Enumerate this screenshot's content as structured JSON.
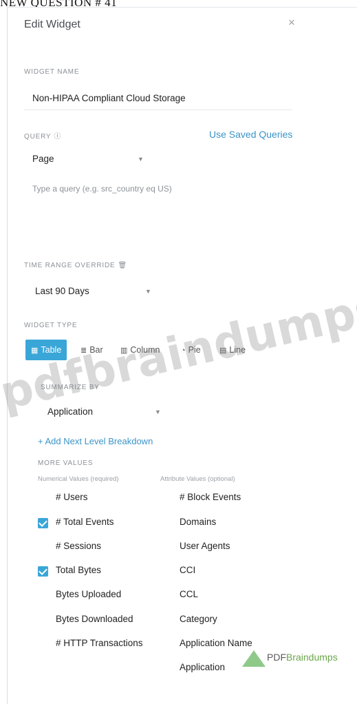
{
  "caption": "NEW QUESTION # 41",
  "dialog": {
    "title": "Edit Widget",
    "close_symbol": "×"
  },
  "widget_name": {
    "label": "WIDGET NAME",
    "value": "Non-HIPAA Compliant Cloud Storage"
  },
  "query": {
    "label": "QUERY",
    "info_icon": "info-icon",
    "use_saved": "Use Saved Queries",
    "scope": "Page",
    "placeholder": "Type a query (e.g. src_country eq US)"
  },
  "time_range": {
    "label": "TIME RANGE OVERRIDE",
    "icon": "trash-icon",
    "value": "Last 90 Days"
  },
  "widget_type": {
    "label": "WIDGET TYPE",
    "options": [
      {
        "label": "Table",
        "icon": "table-icon",
        "active": true
      },
      {
        "label": "Bar",
        "icon": "bar-icon",
        "active": false
      },
      {
        "label": "Column",
        "icon": "column-icon",
        "active": false
      },
      {
        "label": "Pie",
        "icon": "pie-icon",
        "active": false
      },
      {
        "label": "Line",
        "icon": "line-icon",
        "active": false
      }
    ]
  },
  "summarize": {
    "label": "SUMMARIZE BY",
    "value": "Application",
    "add_breakdown": "+ Add Next Level Breakdown"
  },
  "more_values": {
    "label": "MORE VALUES",
    "numerical_header": "Numerical Values (required)",
    "attribute_header": "Attribute Values (optional)",
    "numerical": [
      {
        "label": "# Users",
        "checked": false
      },
      {
        "label": "# Total Events",
        "checked": true
      },
      {
        "label": "# Sessions",
        "checked": false
      },
      {
        "label": "Total Bytes",
        "checked": true
      },
      {
        "label": "Bytes Uploaded",
        "checked": false
      },
      {
        "label": "Bytes Downloaded",
        "checked": false
      },
      {
        "label": "# HTTP Transactions",
        "checked": false
      }
    ],
    "attribute": [
      {
        "label": "# Block Events",
        "checked": false
      },
      {
        "label": "Domains",
        "checked": false
      },
      {
        "label": "User Agents",
        "checked": false
      },
      {
        "label": "CCI",
        "checked": false
      },
      {
        "label": "CCL",
        "checked": false
      },
      {
        "label": "Category",
        "checked": false
      },
      {
        "label": "Application Name",
        "checked": false
      },
      {
        "label": "Application",
        "checked": false
      }
    ]
  },
  "watermark": "pdfbraindumps.com",
  "badge": {
    "prefix": "PDF",
    "suffix": "Braindumps"
  },
  "colors": {
    "accent": "#3aa6d8",
    "link": "#3a94c8"
  }
}
